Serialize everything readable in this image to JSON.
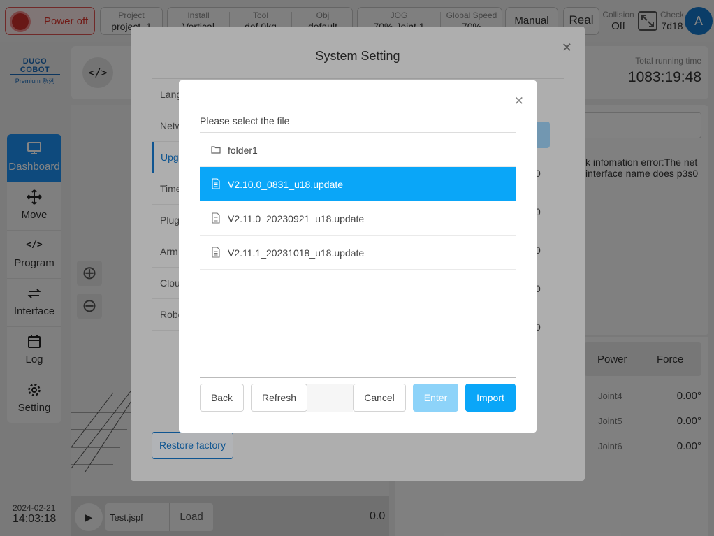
{
  "topbar": {
    "power_label": "Power off",
    "project": {
      "title": "Project",
      "value": "project_1"
    },
    "install": {
      "title": "Install",
      "value": "Vertical"
    },
    "tool": {
      "title": "Tool",
      "value": "def    0kg"
    },
    "obj": {
      "title": "Obj",
      "value": "default"
    },
    "jog": {
      "title": "JOG",
      "value": "70%   Joint 1"
    },
    "global_speed": {
      "title": "Global Speed",
      "value": "70%"
    },
    "mode": "Manual",
    "env": "Real",
    "collision": {
      "title": "Collision",
      "value": "Off"
    },
    "check": {
      "title": "Check",
      "value": "7d18"
    },
    "avatar": "A"
  },
  "logo": {
    "brand": "DUCO COBOT",
    "series": "Premium 系列"
  },
  "sidebar": {
    "items": [
      {
        "label": "Dashboard",
        "icon": "monitor-icon",
        "active": true
      },
      {
        "label": "Move",
        "icon": "move-arrows-icon"
      },
      {
        "label": "Program",
        "icon": "code-icon"
      },
      {
        "label": "Interface",
        "icon": "swap-icon"
      },
      {
        "label": "Log",
        "icon": "calendar-icon"
      },
      {
        "label": "Setting",
        "icon": "gear-icon"
      }
    ]
  },
  "clock": {
    "date": "2024-02-21",
    "time": "14:03:18"
  },
  "background": {
    "running_time_label": "Total running time",
    "running_time_value": "1083:19:48",
    "error_text": "k infomation error:The net interface name does p3s0",
    "program_file": "Test.jspf",
    "load_label": "Load",
    "speed_value": "0.0",
    "joint_tabs": [
      "Power",
      "Force"
    ],
    "joints": [
      {
        "name": "Joint4",
        "value": "0.00°"
      },
      {
        "name": "Joint5",
        "value": "0.00°"
      },
      {
        "name": "Joint6",
        "value": "0.00°"
      }
    ],
    "right_values": [
      "0",
      "0",
      "0",
      "0",
      "0"
    ]
  },
  "system_setting": {
    "title": "System Setting",
    "menu": [
      "Lang",
      "Netw",
      "Upgr",
      "Time",
      "Plug",
      "Arm",
      "Clou",
      "Robo"
    ],
    "selected_menu_index": 2,
    "restore_label": "Restore factory"
  },
  "file_dialog": {
    "title": "Please select the file",
    "files": [
      {
        "name": "folder1",
        "type": "folder",
        "selected": false
      },
      {
        "name": "V2.10.0_0831_u18.update",
        "type": "file",
        "selected": true
      },
      {
        "name": "V2.11.0_20230921_u18.update",
        "type": "file",
        "selected": false
      },
      {
        "name": "V2.11.1_20231018_u18.update",
        "type": "file",
        "selected": false
      }
    ],
    "buttons": {
      "back": "Back",
      "refresh": "Refresh",
      "cancel": "Cancel",
      "enter": "Enter",
      "import": "Import"
    }
  }
}
